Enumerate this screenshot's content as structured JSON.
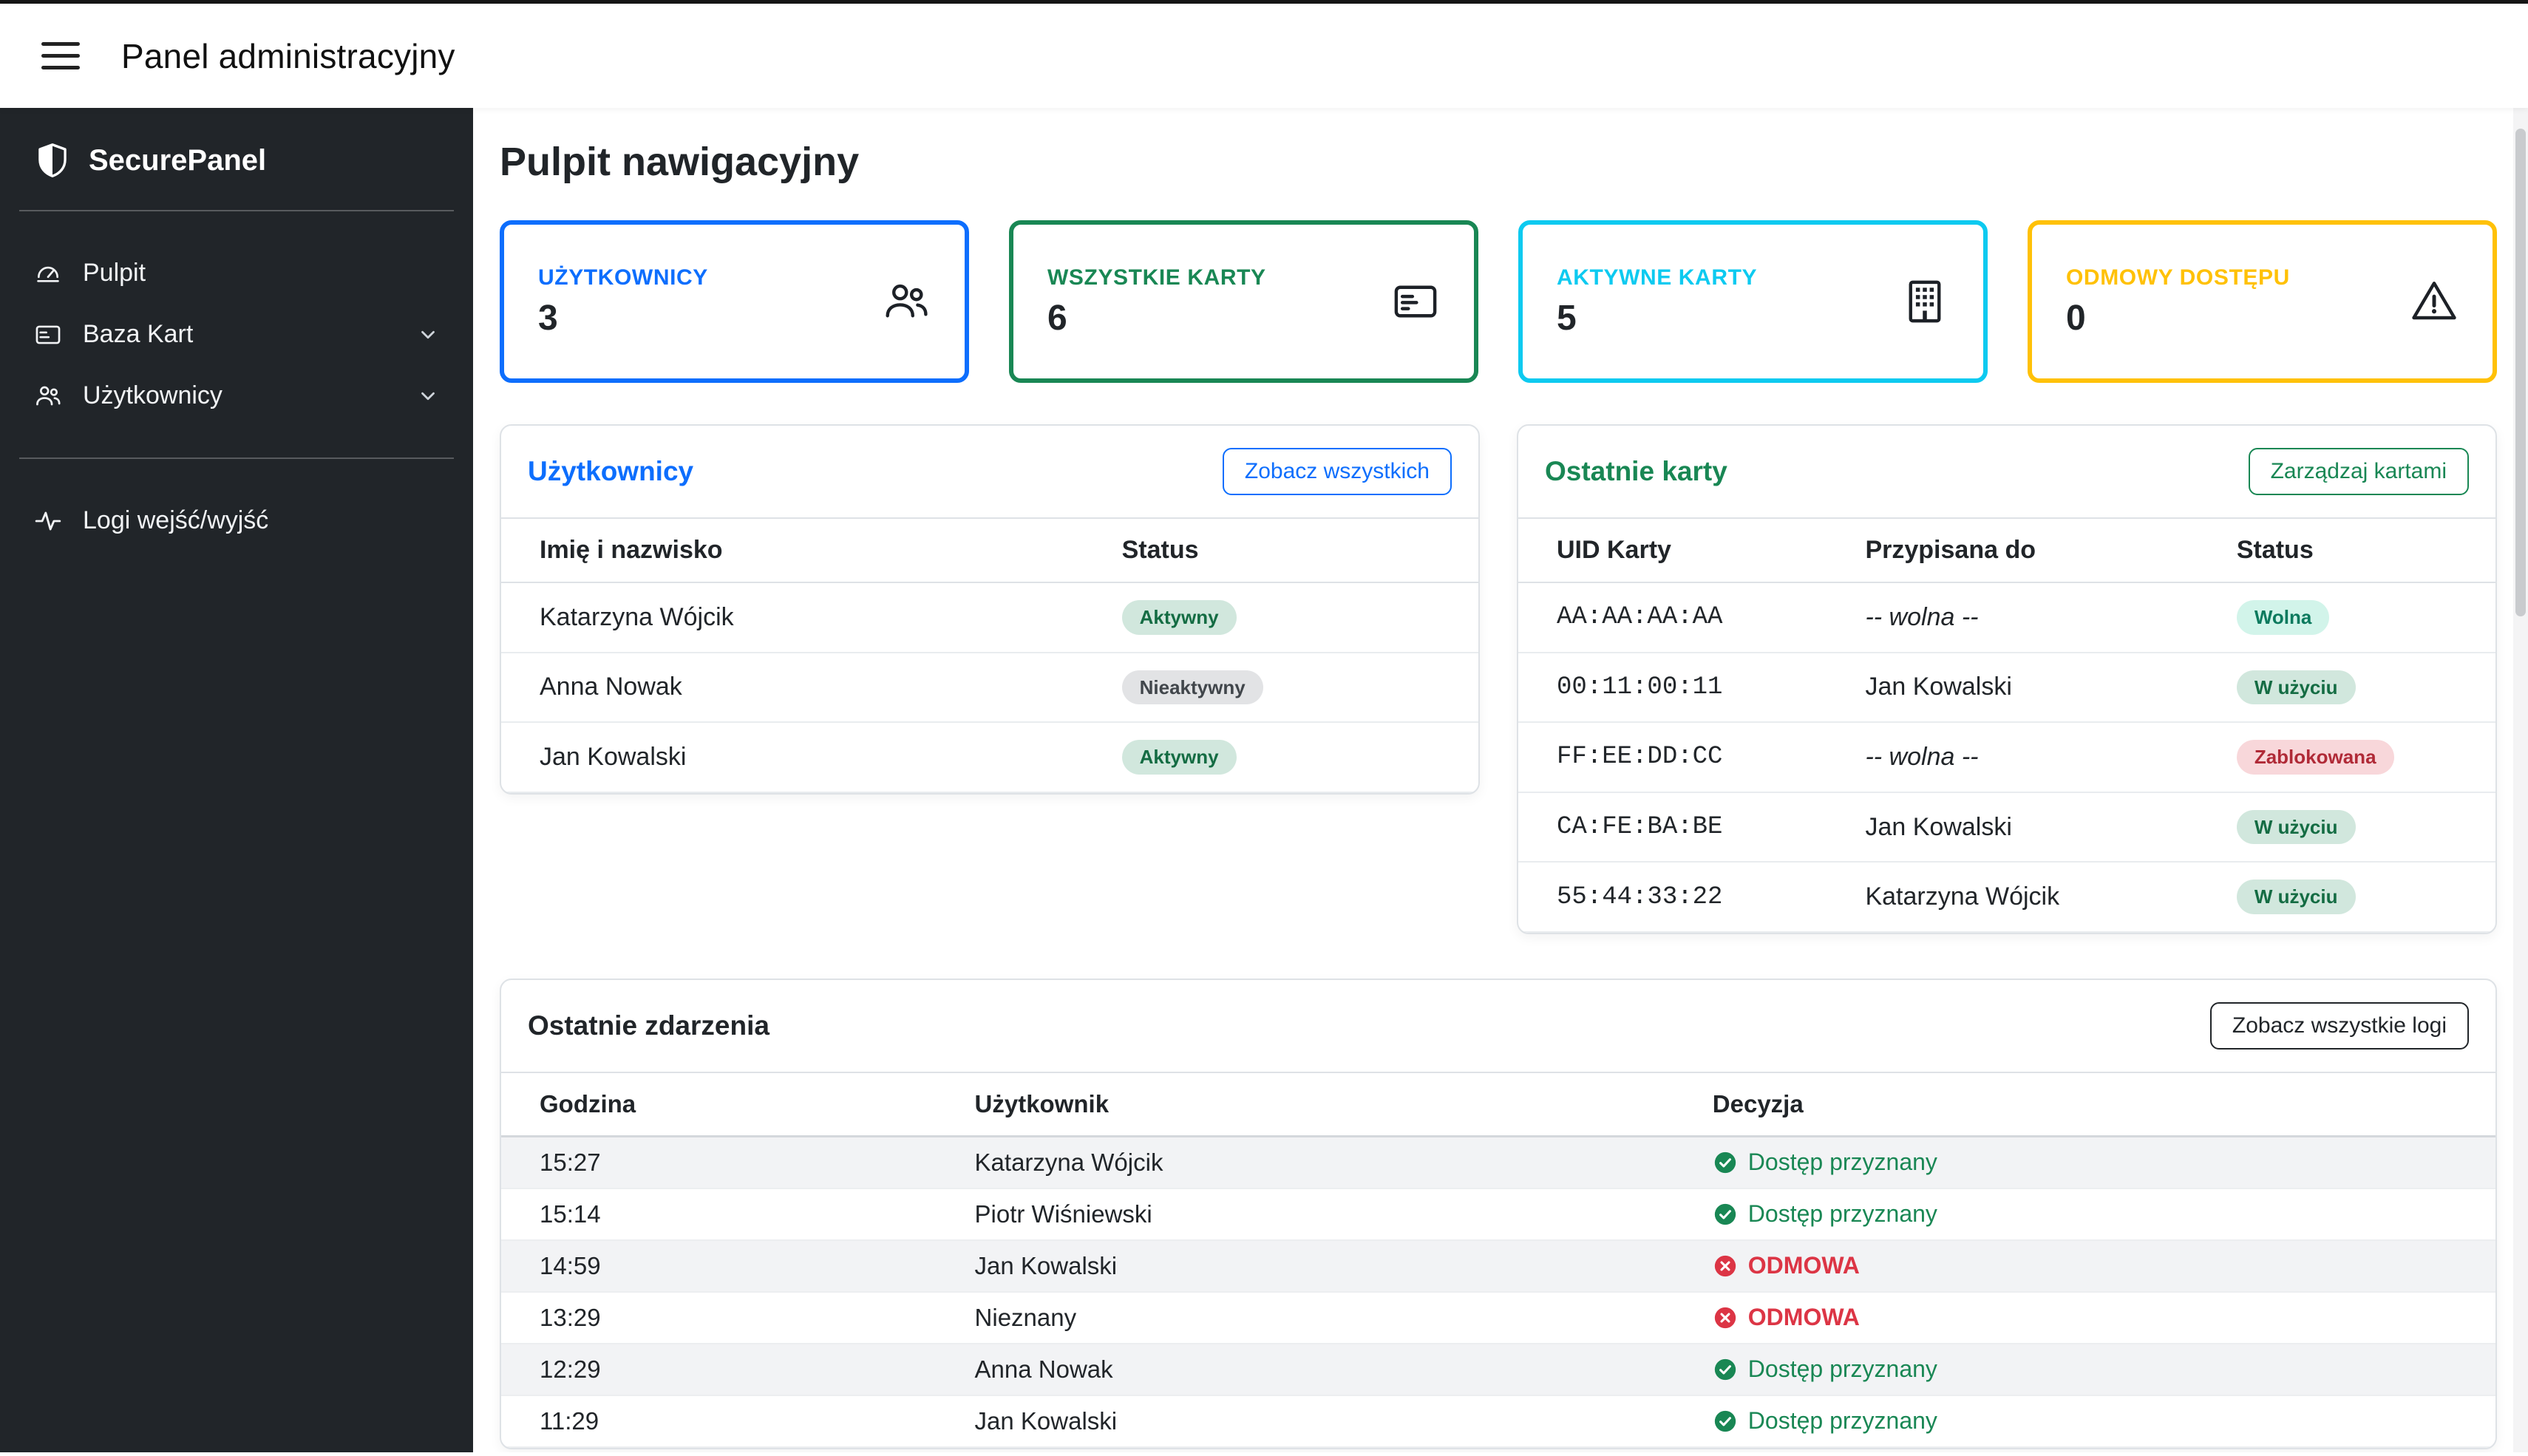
{
  "topbar": {
    "title": "Panel administracyjny"
  },
  "sidebar": {
    "brand": "SecurePanel",
    "items": [
      {
        "label": "Pulpit",
        "icon": "dashboard-icon"
      },
      {
        "label": "Baza Kart",
        "icon": "card-icon"
      },
      {
        "label": "Użytkownicy",
        "icon": "users-icon"
      },
      {
        "label": "Logi wejść/wyjść",
        "icon": "activity-icon"
      }
    ]
  },
  "main": {
    "title": "Pulpit nawigacyjny",
    "stats": [
      {
        "label": "UŻYTKOWNICY",
        "value": "3",
        "color": "#0d6efd",
        "icon": "users-icon"
      },
      {
        "label": "WSZYSTKIE KARTY",
        "value": "6",
        "color": "#198754",
        "icon": "card-icon"
      },
      {
        "label": "AKTYWNE KARTY",
        "value": "5",
        "color": "#0dcaf0",
        "icon": "building-icon"
      },
      {
        "label": "ODMOWY DOSTĘPU",
        "value": "0",
        "color": "#ffc107",
        "icon": "warning-icon"
      }
    ],
    "users_panel": {
      "title": "Użytkownicy",
      "button": "Zobacz wszystkich",
      "columns": [
        "Imię i nazwisko",
        "Status"
      ],
      "rows": [
        {
          "name": "Katarzyna Wójcik",
          "status": "Aktywny"
        },
        {
          "name": "Anna Nowak",
          "status": "Nieaktywny"
        },
        {
          "name": "Jan Kowalski",
          "status": "Aktywny"
        }
      ]
    },
    "cards_panel": {
      "title": "Ostatnie karty",
      "button": "Zarządzaj kartami",
      "columns": [
        "UID Karty",
        "Przypisana do",
        "Status"
      ],
      "rows": [
        {
          "uid": "AA:AA:AA:AA",
          "assigned": "-- wolna --",
          "status": "Wolna"
        },
        {
          "uid": "00:11:00:11",
          "assigned": "Jan Kowalski",
          "status": "W użyciu"
        },
        {
          "uid": "FF:EE:DD:CC",
          "assigned": "-- wolna --",
          "status": "Zablokowana"
        },
        {
          "uid": "CA:FE:BA:BE",
          "assigned": "Jan Kowalski",
          "status": "W użyciu"
        },
        {
          "uid": "55:44:33:22",
          "assigned": "Katarzyna Wójcik",
          "status": "W użyciu"
        }
      ]
    },
    "events_panel": {
      "title": "Ostatnie zdarzenia",
      "button": "Zobacz wszystkie logi",
      "columns": [
        "Godzina",
        "Użytkownik",
        "Decyzja"
      ],
      "rows": [
        {
          "time": "15:27",
          "user": "Katarzyna Wójcik",
          "decision": "Dostęp przyznany",
          "granted": true
        },
        {
          "time": "15:14",
          "user": "Piotr Wiśniewski",
          "decision": "Dostęp przyznany",
          "granted": true
        },
        {
          "time": "14:59",
          "user": "Jan Kowalski",
          "decision": "ODMOWA",
          "granted": false
        },
        {
          "time": "13:29",
          "user": "Nieznany",
          "decision": "ODMOWA",
          "granted": false
        },
        {
          "time": "12:29",
          "user": "Anna Nowak",
          "decision": "Dostęp przyznany",
          "granted": true
        },
        {
          "time": "11:29",
          "user": "Jan Kowalski",
          "decision": "Dostęp przyznany",
          "granted": true
        }
      ]
    }
  },
  "colors": {
    "primary": "#0d6efd",
    "success": "#198754",
    "info": "#0dcaf0",
    "warning": "#ffc107",
    "danger": "#dc3545",
    "sidebar_bg": "#212529"
  }
}
